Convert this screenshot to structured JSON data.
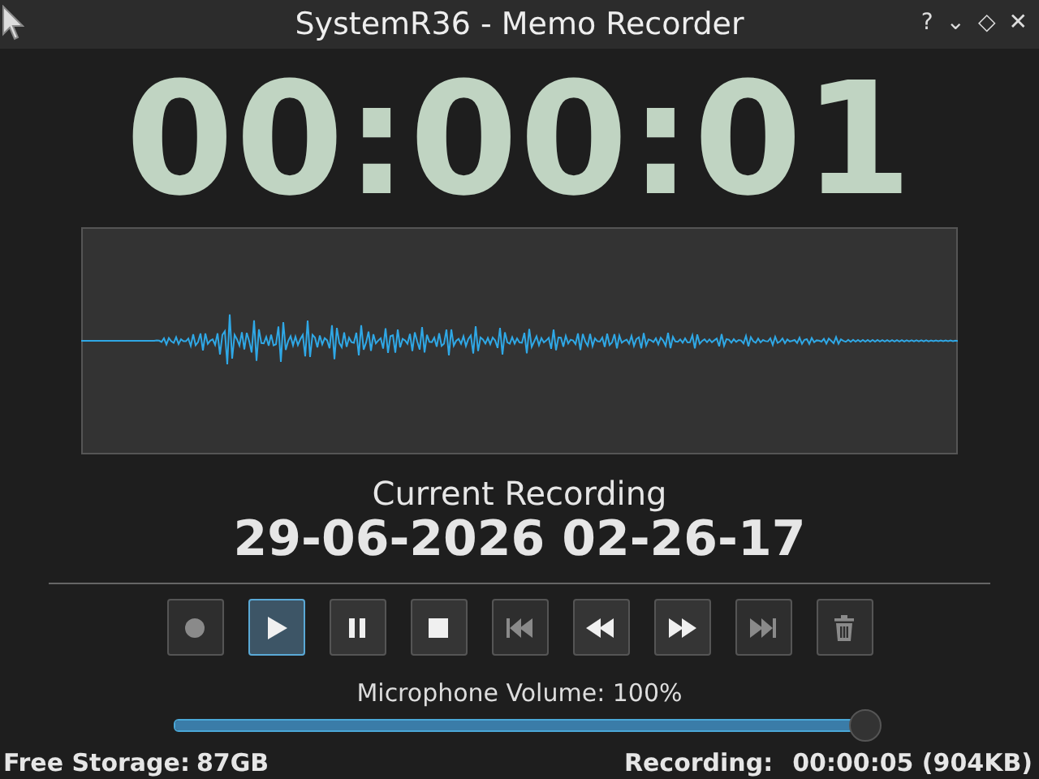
{
  "window": {
    "title": "SystemR36 - Memo Recorder",
    "controls": [
      "?",
      "⌄",
      "◇",
      "✕"
    ]
  },
  "timer": "00:00:01",
  "recording_label": "Current Recording",
  "recording_name": "29-06-2026 02-26-17",
  "buttons": [
    {
      "kind": "record",
      "selected": false,
      "disabled": true
    },
    {
      "kind": "play",
      "selected": true,
      "disabled": false
    },
    {
      "kind": "pause",
      "selected": false,
      "disabled": false
    },
    {
      "kind": "stop",
      "selected": false,
      "disabled": false
    },
    {
      "kind": "skip-back",
      "selected": false,
      "disabled": true
    },
    {
      "kind": "rewind",
      "selected": false,
      "disabled": false
    },
    {
      "kind": "fast-forward",
      "selected": false,
      "disabled": false
    },
    {
      "kind": "skip-forward",
      "selected": false,
      "disabled": true
    },
    {
      "kind": "delete",
      "selected": false,
      "disabled": true
    }
  ],
  "volume": {
    "label": "Microphone Volume: 100%",
    "level": 1
  },
  "status_bar": {
    "storage_label": "Free Storage:",
    "storage_value": "87GB",
    "recording_label": "Recording:",
    "recording_value": "00:00:05 (904KB)"
  }
}
